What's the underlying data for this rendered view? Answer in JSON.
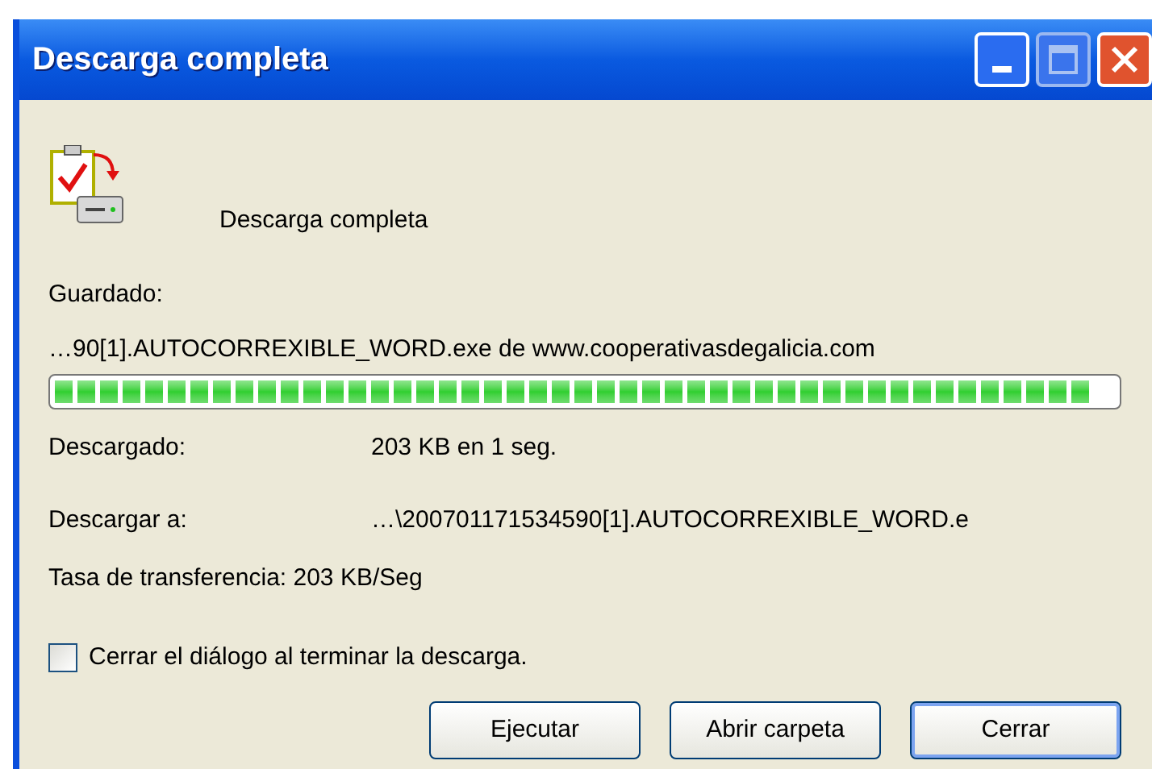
{
  "window": {
    "title": "Descarga completa"
  },
  "header": "Descarga completa",
  "saved_label": "Guardado:",
  "saved_path": "…90[1].AUTOCORREXIBLE_WORD.exe de www.cooperativasdegalicia.com",
  "progress": {
    "level": 1
  },
  "details": [
    {
      "label": "Descargado:",
      "value": "203 KB en 1 seg."
    },
    {
      "label": "Descargar a:",
      "value": "…\\200701171534590[1].AUTOCORREXIBLE_WORD.e"
    }
  ],
  "transfer_rate": "Tasa de transferencia: 203 KB/Seg",
  "close_option": {
    "label": "Cerrar el diálogo al terminar la descarga.",
    "checked": false
  },
  "buttons": [
    {
      "label": "Ejecutar",
      "selected": false
    },
    {
      "label": "Abrir carpeta",
      "selected": false
    },
    {
      "label": "Cerrar",
      "selected": true
    }
  ]
}
